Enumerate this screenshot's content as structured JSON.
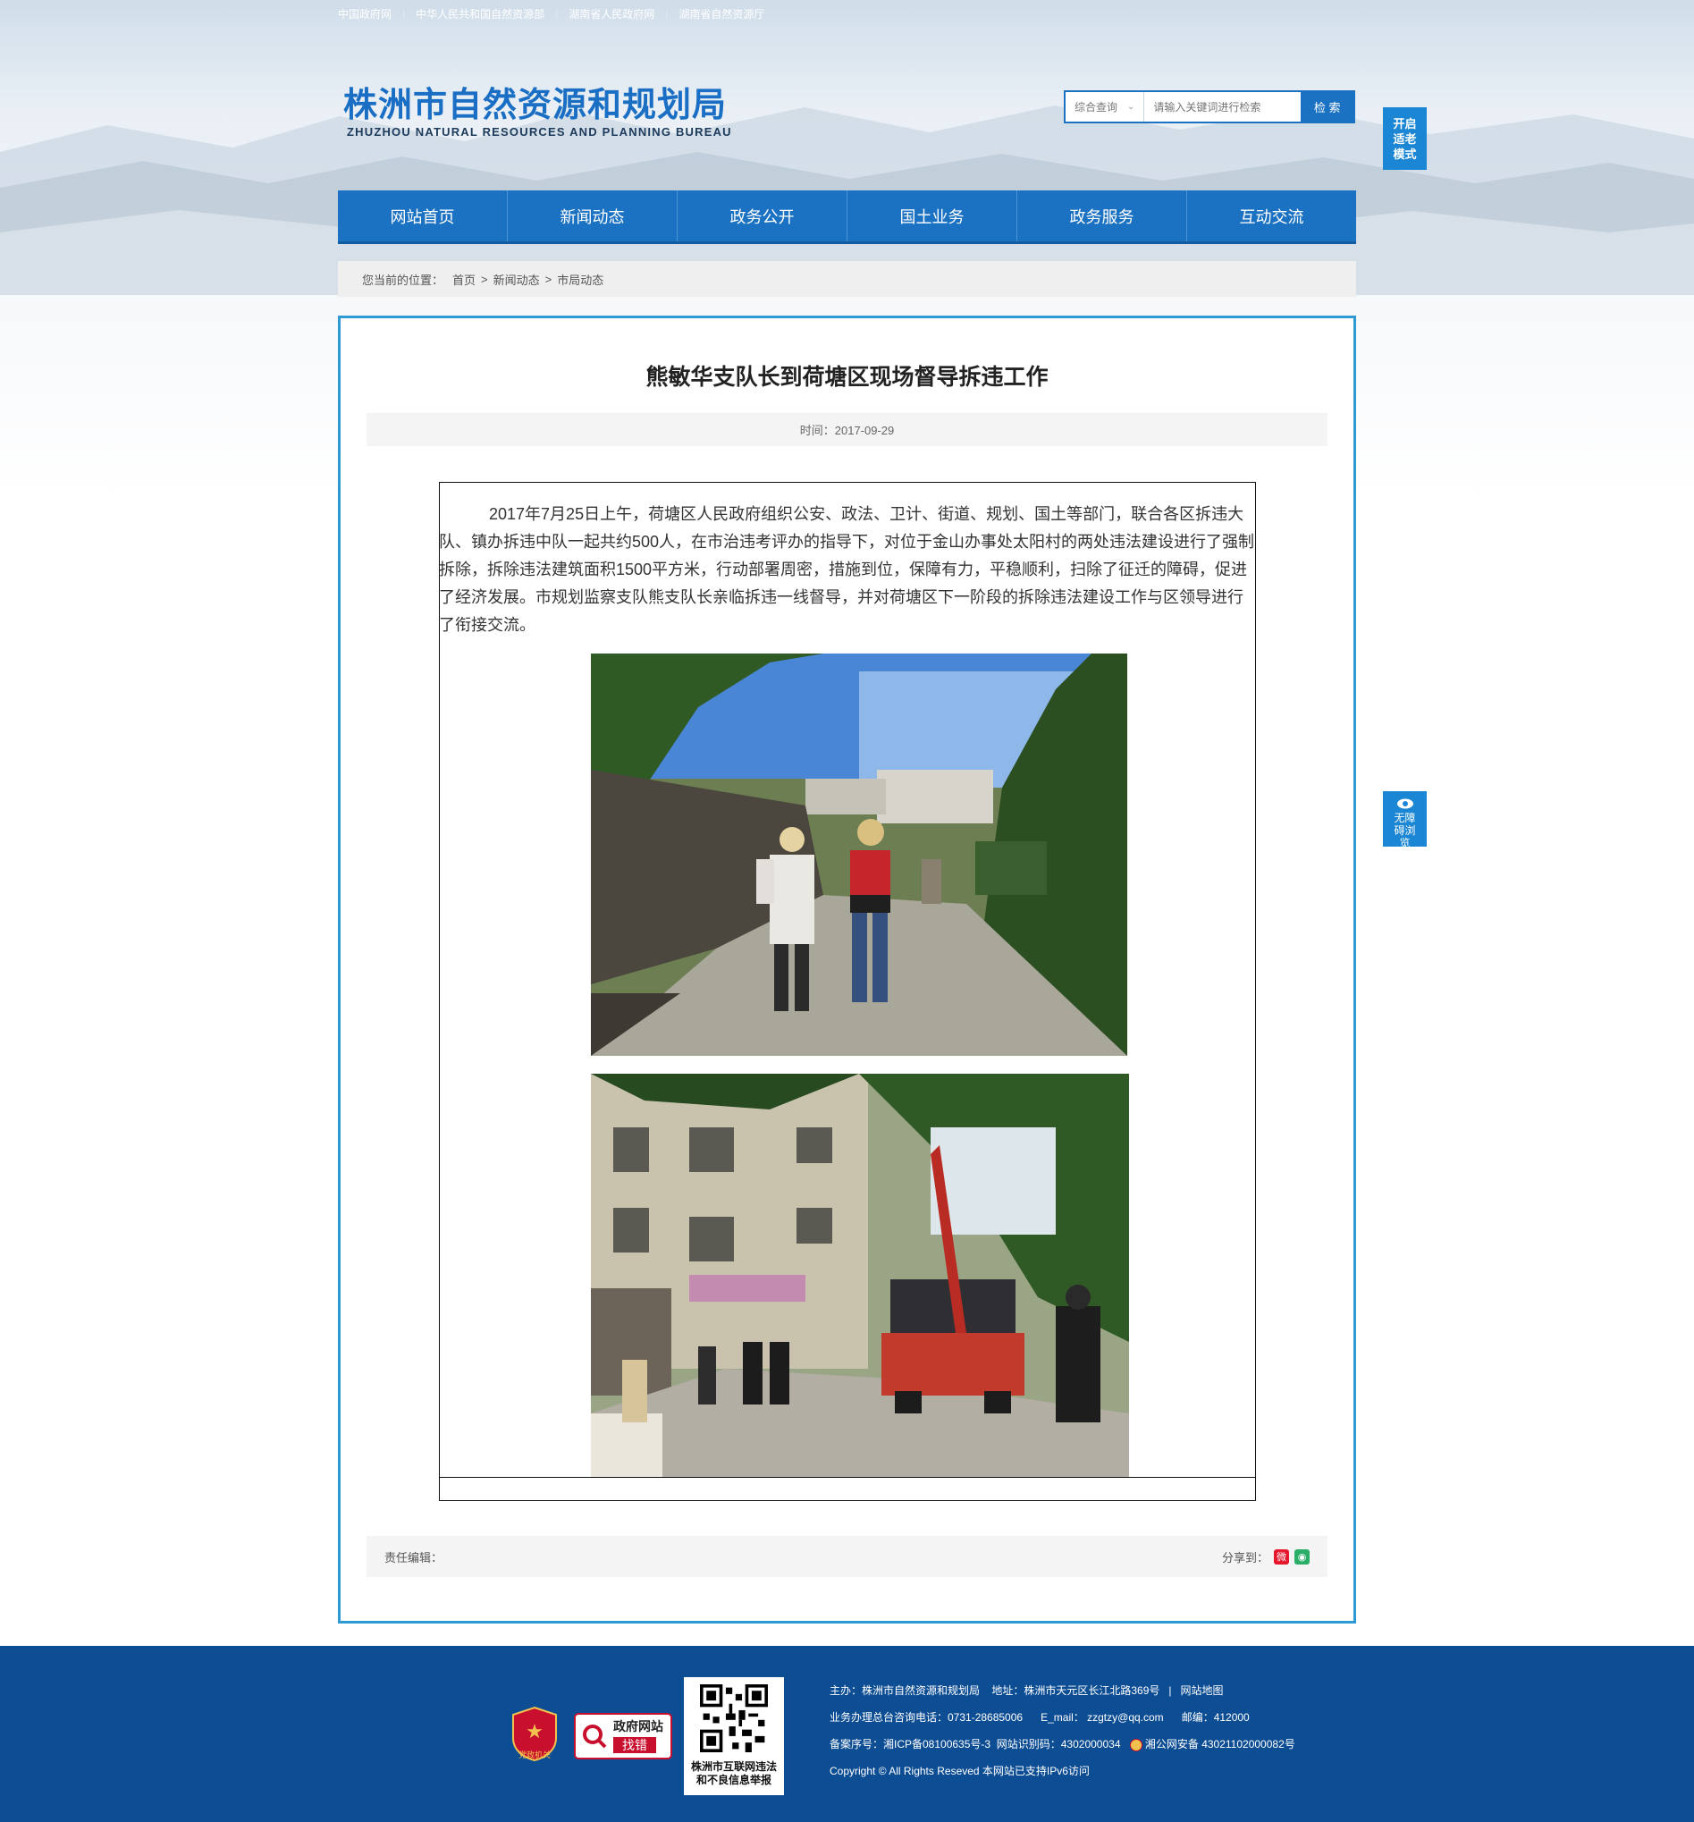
{
  "top_links": [
    "中国政府网",
    "中华人民共和国自然资源部",
    "湖南省人民政府网",
    "湖南省自然资源厅"
  ],
  "header": {
    "title_cn": "株洲市自然资源和规划局",
    "title_en": "ZHUZHOU NATURAL RESOURCES AND PLANNING BUREAU",
    "search_scope": "综合查询",
    "search_placeholder": "请输入关键词进行检索",
    "search_button": "检 索",
    "elder_mode": "开启适老模式",
    "barrier_free": "无障碍浏览"
  },
  "nav": [
    "网站首页",
    "新闻动态",
    "政务公开",
    "国土业务",
    "政务服务",
    "互动交流"
  ],
  "breadcrumb": {
    "prefix": "您当前的位置：",
    "items": [
      "首页",
      "新闻动态",
      "市局动态"
    ]
  },
  "article": {
    "title": "熊敏华支队长到荷塘区现场督导拆违工作",
    "time": "时间：2017-09-29",
    "body": "2017年7月25日上午，荷塘区人民政府组织公安、政法、卫计、街道、规划、国土等部门，联合各区拆违大队、镇办拆违中队一起共约500人，在市治违考评办的指导下，对位于金山办事处太阳村的两处违法建设进行了强制拆除，拆除违法建筑面积1500平方米，行动部署周密，措施到位，保障有力，平稳顺利，扫除了征迁的障碍，促进了经济发展。市规划监察支队熊支队长亲临拆违一线督导，并对荷塘区下一阶段的拆除违法建设工作与区领导进行了衔接交流。",
    "editor_label": "责任编辑：",
    "share_label": "分享到："
  },
  "footer": {
    "badge_party": "党政机关",
    "badge_find_error_1": "政府网站",
    "badge_find_error_2": "找错",
    "qr_caption": "株洲市互联网违法和不良信息举报",
    "line1_host": "主办：株洲市自然资源和规划局",
    "line1_addr": "地址：株洲市天元区长江北路369号",
    "line1_sep": "|",
    "line1_map": "网站地图",
    "line2_phone": "业务办理总台咨询电话：0731-28685006",
    "line2_email": "E_mail： zzgtzy@qq.com",
    "line2_zip": "邮编：412000",
    "line3_icp": "备案序号：湘ICP备08100635号-3",
    "line3_code": "网站识别码：4302000034",
    "line3_police": "湘公网安备 43021102000082号",
    "line4": "Copyright © All Rights Reseved 本网站已支持IPv6访问"
  },
  "colors": {
    "primary": "#1b72c2",
    "box_border": "#2d9ad3",
    "footer": "#0d4d94",
    "float_btn": "#1b86d3"
  }
}
